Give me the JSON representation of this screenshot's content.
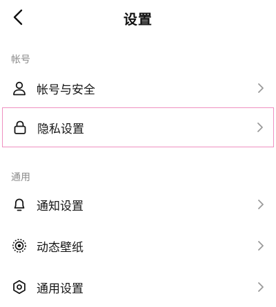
{
  "header": {
    "title": "设置"
  },
  "sections": [
    {
      "label": "帐号",
      "items": [
        {
          "label": "帐号与安全",
          "icon": "person-icon"
        },
        {
          "label": "隐私设置",
          "icon": "lock-icon",
          "highlighted": true
        }
      ]
    },
    {
      "label": "通用",
      "items": [
        {
          "label": "通知设置",
          "icon": "bell-icon"
        },
        {
          "label": "动态壁纸",
          "icon": "live-wallpaper-icon"
        },
        {
          "label": "通用设置",
          "icon": "gear-icon"
        }
      ]
    }
  ],
  "colors": {
    "highlight_border": "#ee8fbf",
    "section_label": "#8a8a8a",
    "chevron": "#9a9a9a"
  }
}
